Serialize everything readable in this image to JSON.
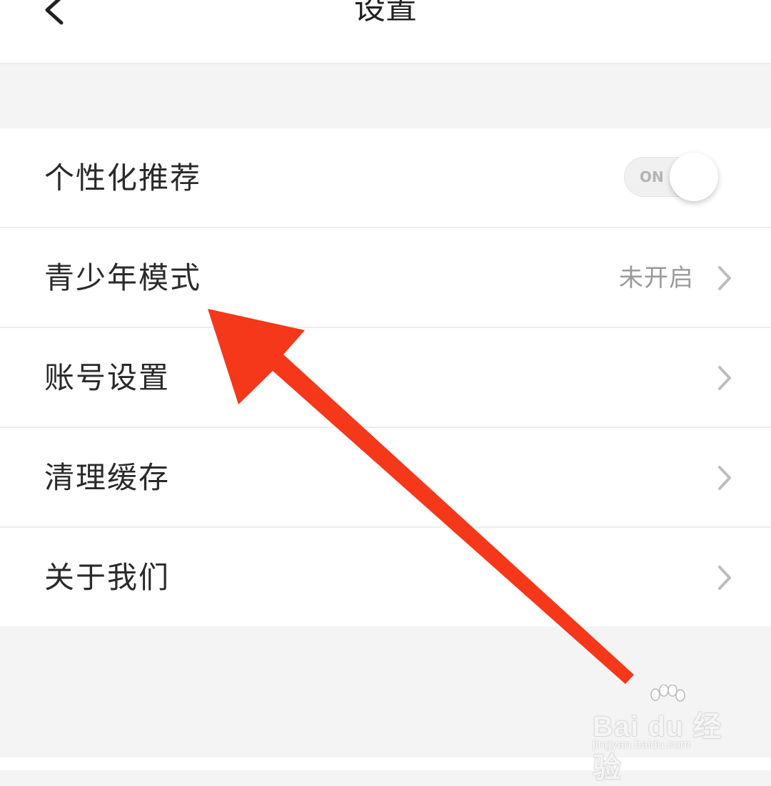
{
  "header": {
    "title": "设置",
    "back_icon": "chevron-left-icon"
  },
  "settings": {
    "items": [
      {
        "label": "个性化推荐",
        "control": "toggle",
        "toggle_text": "ON",
        "toggle_on": true
      },
      {
        "label": "青少年模式",
        "value": "未开启",
        "icon": "chevron-right-icon"
      },
      {
        "label": "账号设置",
        "icon": "chevron-right-icon"
      },
      {
        "label": "清理缓存",
        "icon": "chevron-right-icon"
      },
      {
        "label": "关于我们",
        "icon": "chevron-right-icon"
      }
    ]
  },
  "annotation": {
    "arrow_color": "#f5371a",
    "points_to": "青少年模式"
  },
  "watermark": {
    "logo_text": "Bai du 经验",
    "url": "jingyan.baidu.com"
  },
  "colors": {
    "background": "#f4f4f4",
    "surface": "#ffffff",
    "divider": "#ededed",
    "secondary_text": "#9a9a9a"
  }
}
